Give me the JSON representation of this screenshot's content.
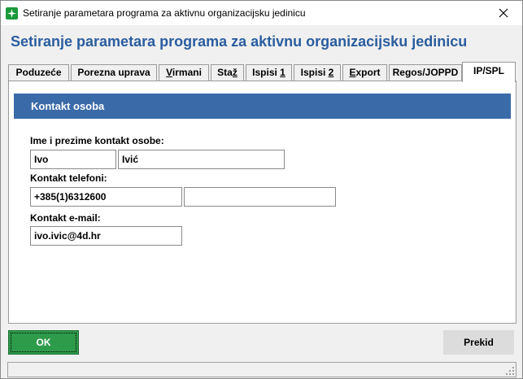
{
  "window": {
    "title": "Setiranje parametara programa za aktivnu organizacijsku jedinicu"
  },
  "heading": "Setiranje parametara programa za aktivnu organizacijsku jedinicu",
  "tabs": [
    {
      "pre": "",
      "key": "",
      "post": "Poduzeće",
      "active": false
    },
    {
      "pre": "Porezna uprava",
      "key": "",
      "post": "",
      "active": false
    },
    {
      "pre": "",
      "key": "V",
      "post": "irmani",
      "active": false
    },
    {
      "pre": "Sta",
      "key": "ž",
      "post": "",
      "active": false
    },
    {
      "pre": "Ispisi ",
      "key": "1",
      "post": "",
      "active": false
    },
    {
      "pre": "Ispisi ",
      "key": "2",
      "post": "",
      "active": false
    },
    {
      "pre": "",
      "key": "E",
      "post": "xport",
      "active": false
    },
    {
      "pre": "Regos/JOPPD",
      "key": "",
      "post": "",
      "active": false
    },
    {
      "pre": "IP/SPL",
      "key": "",
      "post": "",
      "active": true
    }
  ],
  "section": {
    "title": "Kontakt osoba"
  },
  "form": {
    "name_label": "Ime i prezime kontakt osobe:",
    "first_name": "Ivo",
    "last_name": "Ivić",
    "phone_label": "Kontakt telefoni:",
    "phone1": "+385(1)6312600",
    "phone2": "",
    "email_label": "Kontakt e-mail:",
    "email": "ivo.ivic@4d.hr"
  },
  "buttons": {
    "ok": "OK",
    "cancel": "Prekid"
  },
  "colors": {
    "heading": "#2a5d9f",
    "section_header": "#3a6aa8",
    "ok_button": "#2e9b4a"
  }
}
